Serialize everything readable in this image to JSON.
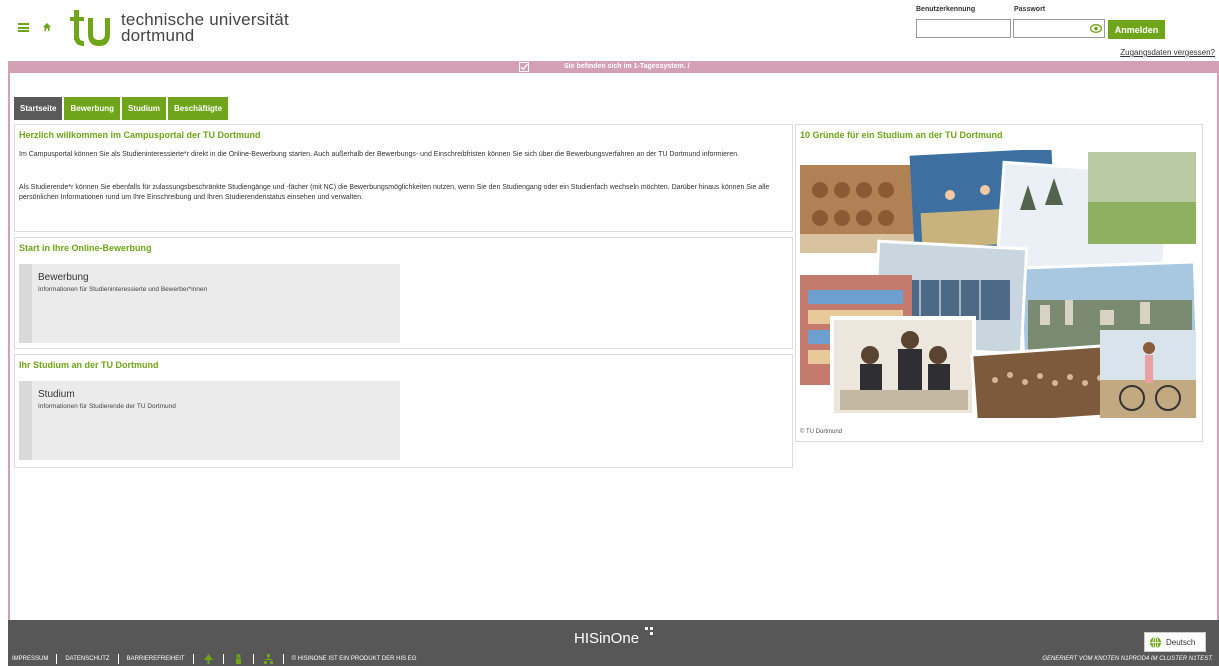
{
  "header": {
    "logo_line1": "technische universität",
    "logo_line2": "dortmund",
    "username_label": "Benutzerkennung",
    "password_label": "Passwort",
    "username_value": "",
    "password_value": "",
    "login_button": "Anmelden",
    "forgot_link": "Zugangsdaten vergessen?"
  },
  "system_bar": {
    "message": "Sie befinden sich im 1-Tagessystem. /"
  },
  "tabs": [
    {
      "label": "Startseite",
      "active": true
    },
    {
      "label": "Bewerbung",
      "active": false
    },
    {
      "label": "Studium",
      "active": false
    },
    {
      "label": "Beschäftigte",
      "active": false
    }
  ],
  "welcome": {
    "title": "Herzlich willkommen im Campusportal der TU Dortmund",
    "para1": "Im Campusportal können Sie als Studieninteressierte*r direkt in die Online-Bewerbung starten. Auch außerhalb der Bewerbungs- und Einschreibfristen können Sie sich über die Bewerbungsverfahren an der TU Dortmund informieren.",
    "para2": "Als Studierende*r können Sie ebenfalls für zulassungsbeschränkte Studiengänge und -fächer (mit NC) die Bewerbungsmöglichkeiten nutzen, wenn Sie den Studiengang oder ein Studienfach wechseln möchten. Darüber hinaus können Sie alle persönlichen Informationen rund um Ihre Einschreibung und Ihren Studierendenstatus einsehen und verwalten."
  },
  "application": {
    "title": "Start in Ihre Online-Bewerbung",
    "card_title": "Bewerbung",
    "card_sub": "Informationen für Studieninteressierte und Bewerber*innen"
  },
  "study": {
    "title": "Ihr Studium an der TU Dortmund",
    "card_title": "Studium",
    "card_sub": "Informationen für Studierende der TU Dortmund"
  },
  "reasons": {
    "title": "10 Gründe für ein Studium an der TU Dortmund",
    "caption": "© TU Dortmund"
  },
  "footer": {
    "brand": "HISinOne",
    "impressum": "IMPRESSUM",
    "datenschutz": "DATENSCHUTZ",
    "barrierefreiheit": "BARRIEREFREIHEIT",
    "his_note": "© HISINONE IST EIN PRODUKT DER HIS EG",
    "generated": "GENERIERT VOM KNOTEN N1PROD4 IM CLUSTER N1TEST.",
    "language_button": "Deutsch"
  },
  "colors": {
    "accent": "#6fa51b",
    "system_bar": "#d4a0b4",
    "footer": "#575757",
    "active_tab": "#5a5a5a"
  }
}
